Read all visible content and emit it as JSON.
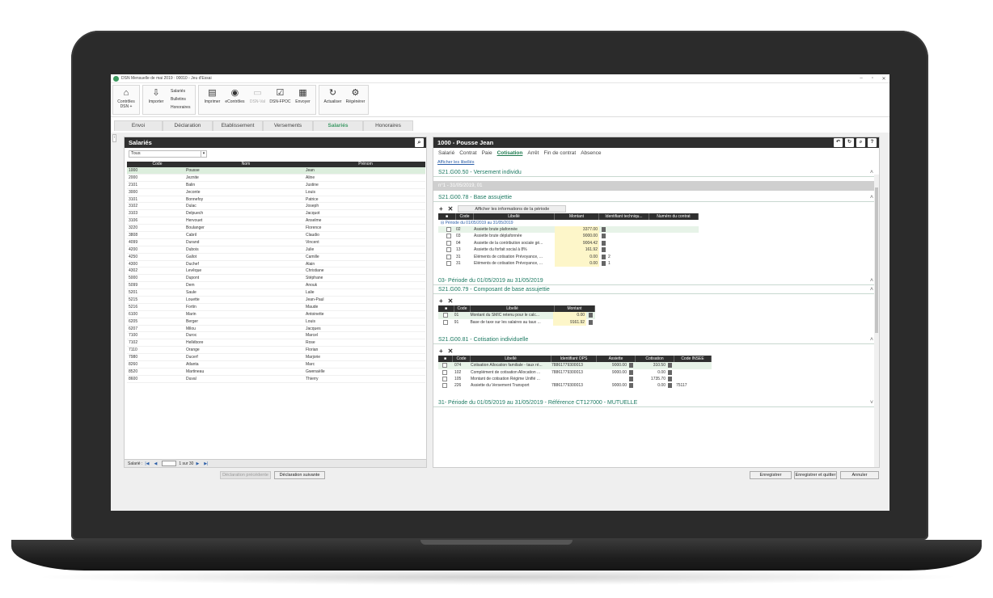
{
  "window": {
    "title": "DSN Mensuelle de mai 2019 : 00010 - Jeu d'Essai"
  },
  "ribbon": {
    "controles_dsn": "Contrôles DSN +",
    "importer": "Importer",
    "list_items": [
      "Salariés",
      "Bulletins",
      "Honoraires"
    ],
    "imprimer": "Imprimer",
    "econtroles": "eContrôles",
    "dsnval": "DSN-Val",
    "dsnfpoc": "DSN-FPOC",
    "envoyer": "Envoyer",
    "actualiser": "Actualiser",
    "regenerer": "Régénérer"
  },
  "tabs": [
    "Envoi",
    "Déclaration",
    "Etablissement",
    "Versements",
    "Salariés",
    "Honoraires"
  ],
  "left": {
    "title": "Salariés",
    "filter": "Tous",
    "columns": [
      "Code",
      "Nom",
      "Prénom"
    ],
    "rows": [
      [
        "1000",
        "Pousse",
        "Jean"
      ],
      [
        "2000",
        "Jeznite",
        "Aline"
      ],
      [
        "2101",
        "Balin",
        "Justine"
      ],
      [
        "3000",
        "Jeconte",
        "Louis"
      ],
      [
        "3101",
        "Bonnefoy",
        "Patrice"
      ],
      [
        "3102",
        "Dulac",
        "Joseph"
      ],
      [
        "3103",
        "Delpuech",
        "Jacquot"
      ],
      [
        "3106",
        "Hervouet",
        "Anselme"
      ],
      [
        "3220",
        "Boulanger",
        "Florence"
      ],
      [
        "3808",
        "Cabril",
        "Claudio"
      ],
      [
        "4099",
        "Durand",
        "Vincent"
      ],
      [
        "4200",
        "Dubois",
        "Julie"
      ],
      [
        "4250",
        "Gallot",
        "Camille"
      ],
      [
        "4300",
        "Duchef",
        "Alain"
      ],
      [
        "4302",
        "Levêque",
        "Christiane"
      ],
      [
        "5000",
        "Dupont",
        "Stéphane"
      ],
      [
        "5099",
        "Dem",
        "Anouk"
      ],
      [
        "5201",
        "Saule",
        "Lalie"
      ],
      [
        "5215",
        "Louette",
        "Jean-Paul"
      ],
      [
        "5216",
        "Fortin",
        "Maude"
      ],
      [
        "6100",
        "Marin",
        "Antoinette"
      ],
      [
        "6205",
        "Berger",
        "Louis"
      ],
      [
        "6207",
        "Milou",
        "Jacques"
      ],
      [
        "7100",
        "Duroc",
        "Marcel"
      ],
      [
        "7102",
        "Hellébore",
        "Rose"
      ],
      [
        "7110",
        "Orange",
        "Florian"
      ],
      [
        "7980",
        "Ducerf",
        "Marjorie"
      ],
      [
        "8260",
        "Atlanta",
        "Marc"
      ],
      [
        "8520",
        "Martineau",
        "Gwenaëlle"
      ],
      [
        "8600",
        "Duval",
        "Thierry"
      ]
    ],
    "footer": {
      "label": "Salarié :",
      "page": "1",
      "sur": "sur",
      "total": "30"
    }
  },
  "right": {
    "title": "1000 - Pousse Jean",
    "subtabs": [
      "Salarié",
      "Contrat",
      "Paie",
      "Cotisation",
      "Arrêt",
      "Fin de contrat",
      "Absence"
    ],
    "active_subtab": "Cotisation",
    "show_labels": "Afficher les libellés",
    "s50": "S21.G00.50 - Versement individu",
    "s50_grey": "n°1 - 31/05/2019, 01",
    "s78": "S21.G00.78 - Base assujettie",
    "s78_info": "Afficher les informations de la période",
    "s78_cols": [
      "Code",
      "Libellé",
      "Montant",
      "Identifiant techniqu...",
      "Numéro du contrat"
    ],
    "s78_period": "Période du 01/05/2019 au 31/05/2019",
    "s78_rows": [
      [
        "02",
        "Assiette brute plafonnée",
        "3377.00",
        ""
      ],
      [
        "03",
        "Assiette brute déplafonnée",
        "9000.00",
        ""
      ],
      [
        "04",
        "Assiette de la contribution sociale gé...",
        "9004.42",
        ""
      ],
      [
        "13",
        "Assiette du forfait social à 8%",
        "161.92",
        ""
      ],
      [
        "31",
        "Eléments de cotisation Prévoyance, ...",
        "0.00",
        "2"
      ],
      [
        "31",
        "Eléments de cotisation Prévoyance, ...",
        "0.00",
        "1"
      ]
    ],
    "s03": "03- Période du 01/05/2019 au 31/05/2019",
    "s79": "S21.G00.79 - Composant de base assujettie",
    "s79_cols": [
      "Code",
      "Libellé",
      "Montant"
    ],
    "s79_rows": [
      [
        "01",
        "Montant du SMIC retenu pour le calc...",
        "0.00"
      ],
      [
        "91",
        "Base de taxe sur les salaires au taux ...",
        "9161.92"
      ]
    ],
    "s81": "S21.G00.81 - Cotisation individuelle",
    "s81_cols": [
      "Code",
      "Libellé",
      "Identifiant OPS",
      "Assiette",
      "Cotisation",
      "Code INSEE"
    ],
    "s81_rows": [
      [
        "074",
        "Cotisation Allocation familiale - taux ré...",
        "78861779300013",
        "9000.00",
        "310.50",
        ""
      ],
      [
        "102",
        "Complément de cotisation Allocation ...",
        "78861779300013",
        "9000.00",
        "0.00",
        ""
      ],
      [
        "105",
        "Montant de cotisation Régime Unifié ...",
        "",
        "",
        "1735.70",
        ""
      ],
      [
        "226",
        "Assiette du Versement Transport",
        "78861779300013",
        "9000.00",
        "0.00",
        "75117"
      ]
    ],
    "s31": "31- Période du 01/05/2019 au 31/05/2019 - Référence CT127000 - MUTUELLE"
  },
  "buttons": {
    "prev": "Déclaration précédente",
    "next": "Déclaration suivante",
    "save": "Enregistrer",
    "save_quit": "Enregistrer et quitter",
    "cancel": "Annuler"
  }
}
